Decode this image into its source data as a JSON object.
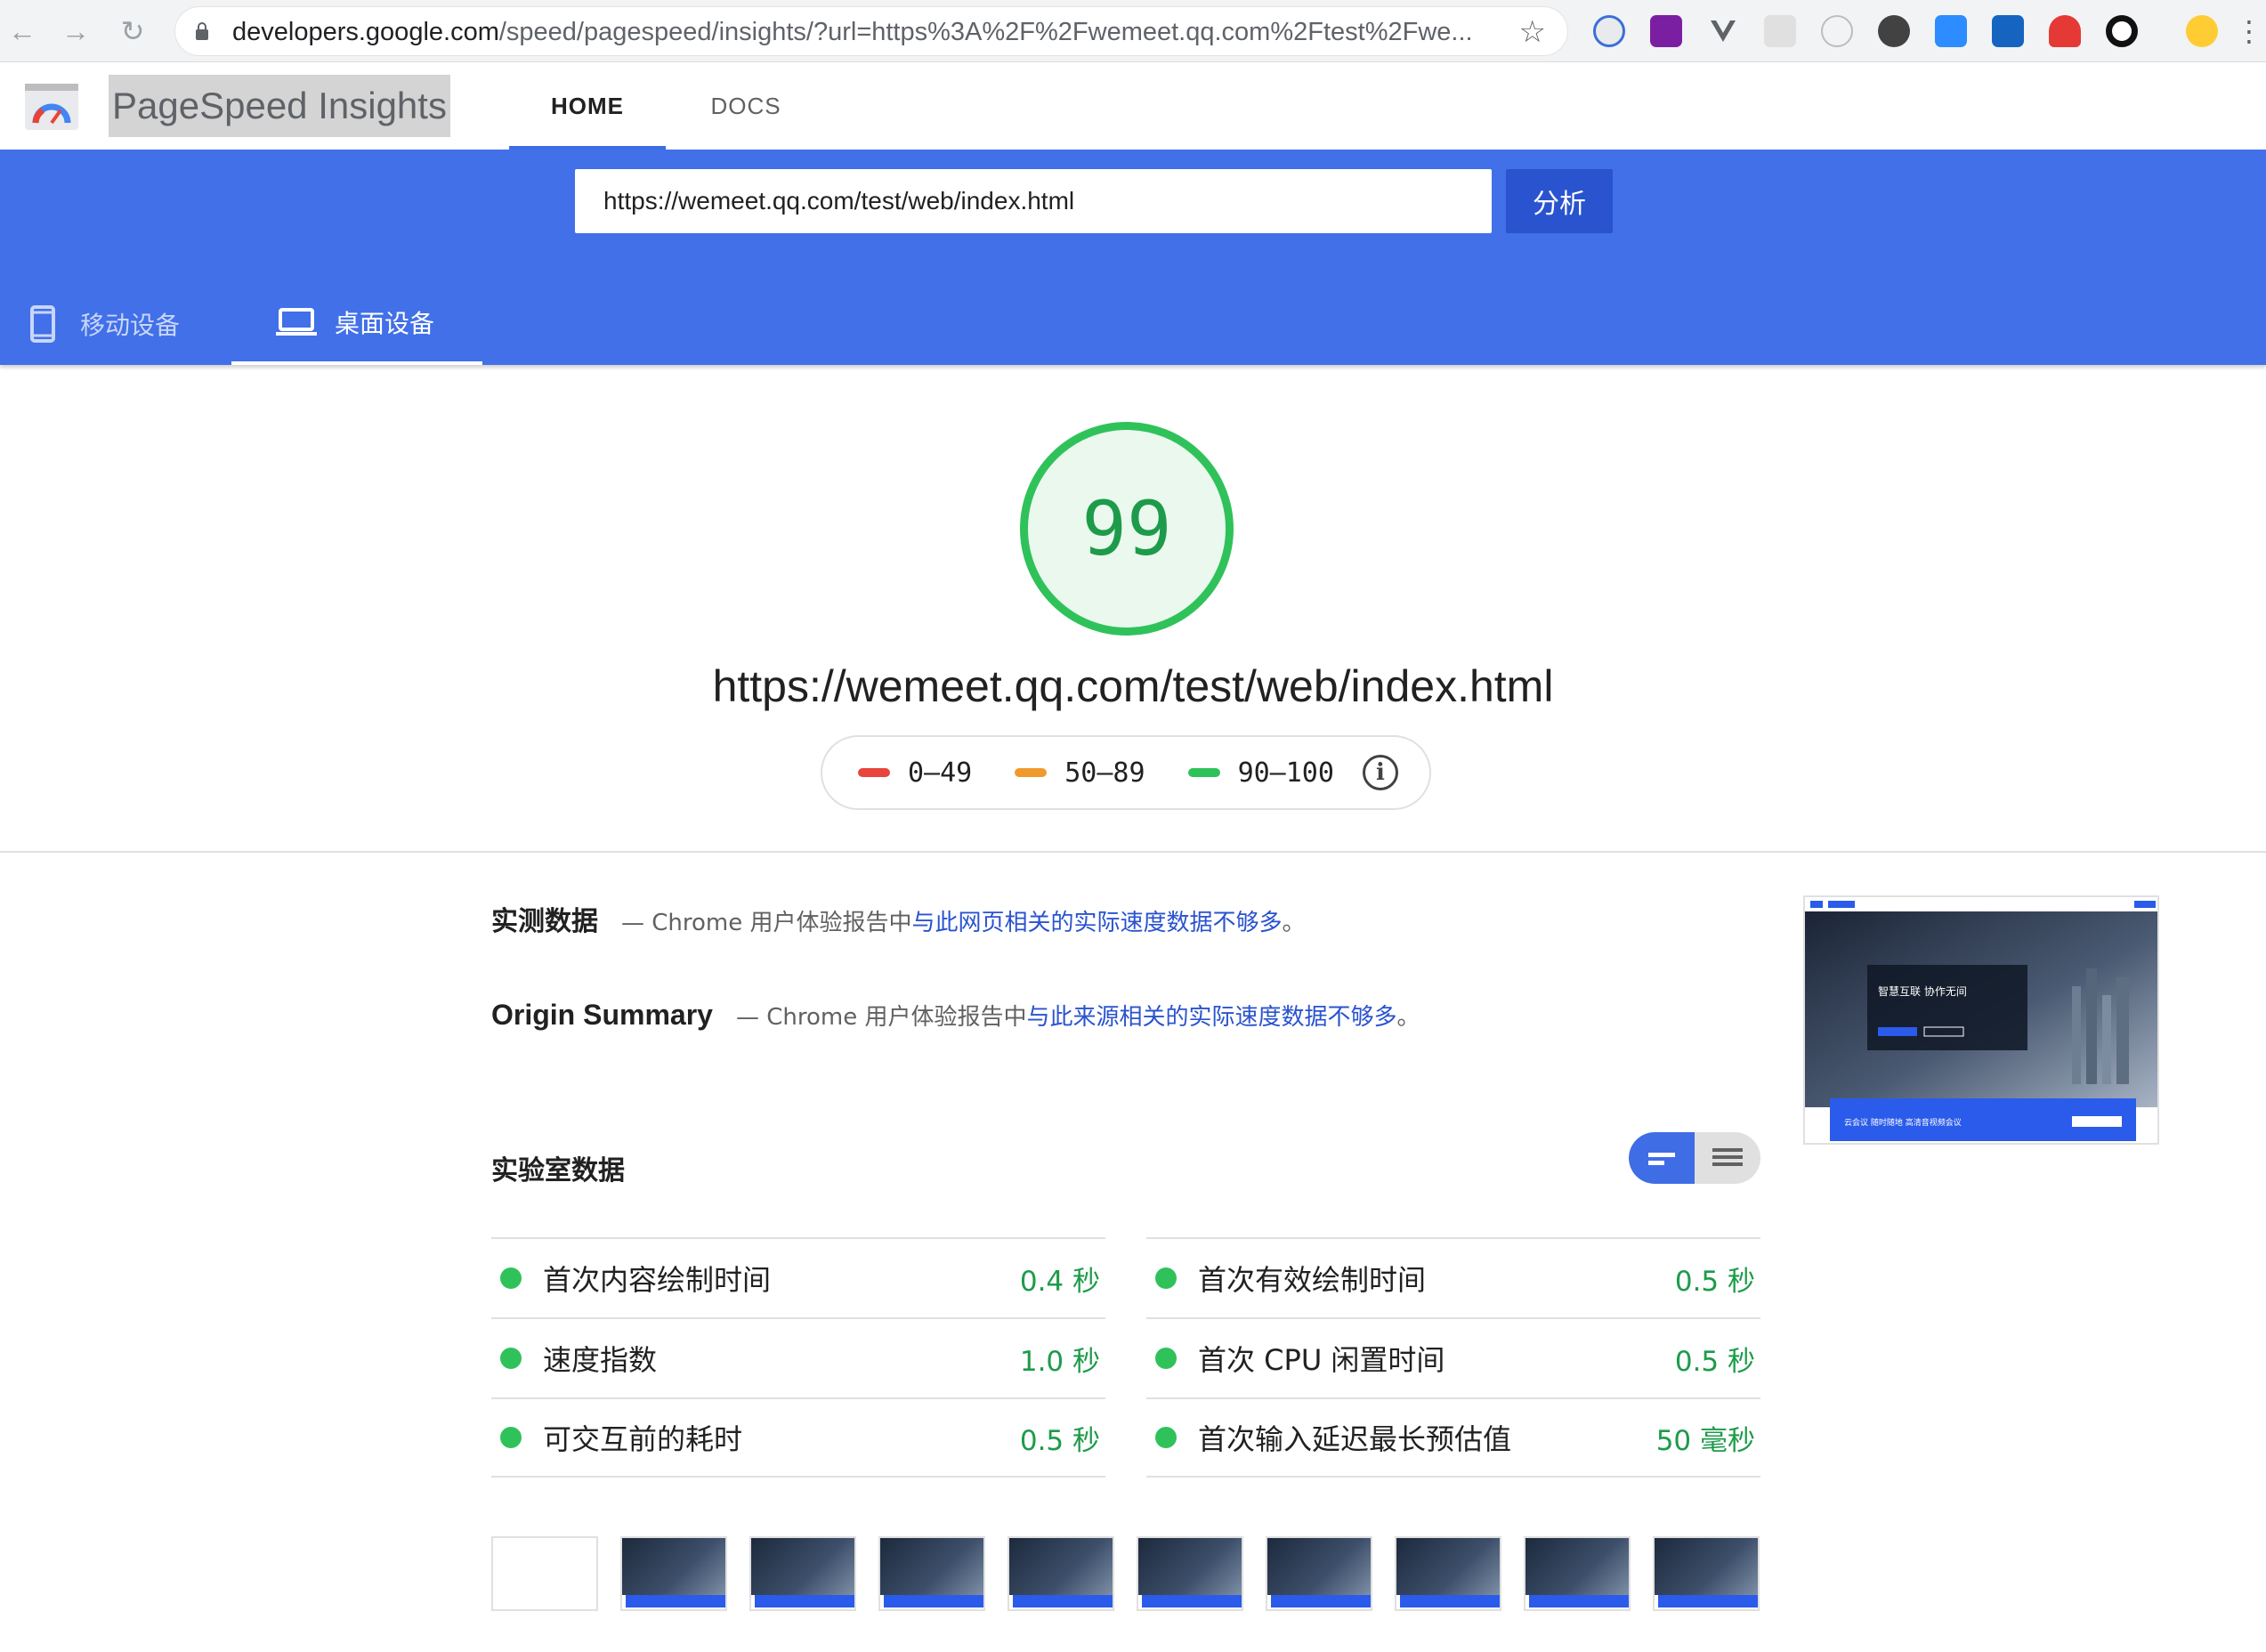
{
  "browser": {
    "url_host": "developers.google.com",
    "url_rest": "/speed/pagespeed/insights/?url=https%3A%2F%2Fwemeet.qq.com%2Ftest%2Fwe..."
  },
  "header": {
    "title": "PageSpeed Insights",
    "tabs": [
      {
        "label": "HOME",
        "active": true
      },
      {
        "label": "DOCS",
        "active": false
      }
    ]
  },
  "search": {
    "value": "https://wemeet.qq.com/test/web/index.html",
    "button_label": "分析"
  },
  "device_tabs": [
    {
      "label": "移动设备",
      "active": false
    },
    {
      "label": "桌面设备",
      "active": true
    }
  ],
  "score": {
    "value": "99",
    "url": "https://wemeet.qq.com/test/web/index.html"
  },
  "legend": [
    {
      "label": "0–49",
      "color": "#ff4e42"
    },
    {
      "label": "50–89",
      "color": "#ffa400"
    },
    {
      "label": "90–100",
      "color": "#0cce6b"
    }
  ],
  "field_data": {
    "title": "实测数据",
    "desc_prefix": "— Chrome 用户体验报告中",
    "desc_link": "与此网页相关的实际速度数据不够多",
    "desc_suffix": "。"
  },
  "origin_summary": {
    "title": "Origin Summary",
    "desc_prefix": "— Chrome 用户体验报告中",
    "desc_link": "与此来源相关的实际速度数据不够多",
    "desc_suffix": "。"
  },
  "lab_data": {
    "title": "实验室数据",
    "metrics_left": [
      {
        "name": "首次内容绘制时间",
        "value": "0.4 秒"
      },
      {
        "name": "速度指数",
        "value": "1.0 秒"
      },
      {
        "name": "可交互前的耗时",
        "value": "0.5 秒"
      }
    ],
    "metrics_right": [
      {
        "name": "首次有效绘制时间",
        "value": "0.5 秒"
      },
      {
        "name": "首次 CPU 闲置时间",
        "value": "0.5 秒"
      },
      {
        "name": "首次输入延迟最长预估值",
        "value": "50 毫秒"
      }
    ]
  },
  "final_screenshot": {
    "headline": "智慧互联 协作无间",
    "banner": "云会议 随时随地 高清音视频会议"
  },
  "colors": {
    "accent_blue": "#4170e8",
    "pass_green": "#30c25a",
    "link_blue": "#2a53cf"
  }
}
